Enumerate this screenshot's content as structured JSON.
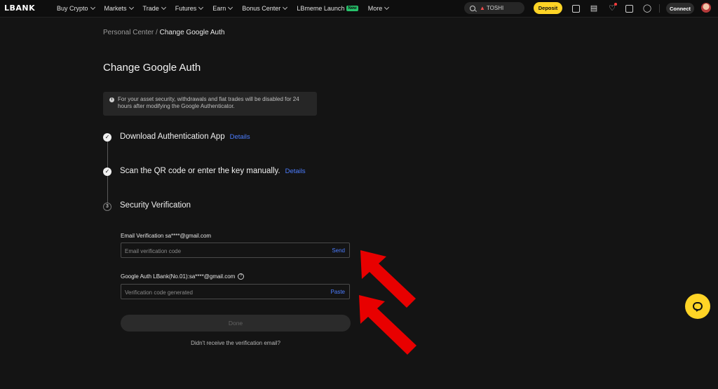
{
  "nav": {
    "logo": "LBANK",
    "items": [
      {
        "label": "Buy Crypto",
        "dropdown": true
      },
      {
        "label": "Markets",
        "dropdown": true
      },
      {
        "label": "Trade",
        "dropdown": true
      },
      {
        "label": "Futures",
        "dropdown": true
      },
      {
        "label": "Earn",
        "dropdown": true
      },
      {
        "label": "Bonus Center",
        "dropdown": true
      },
      {
        "label": "LBmeme Launch",
        "badge": "New",
        "dropdown": false
      },
      {
        "label": "More",
        "dropdown": true
      }
    ],
    "search_text": "TOSHI",
    "deposit_label": "Deposit",
    "connect_label": "Connect"
  },
  "breadcrumb": {
    "parent": "Personal Center",
    "separator": "/",
    "current": "Change Google Auth"
  },
  "page_title": "Change Google Auth",
  "notice": "For your asset security, withdrawals and fiat trades will be disabled for 24 hours after modifying the Google Authenticator.",
  "steps": [
    {
      "label": "Download Authentication App",
      "link": "Details",
      "status": "done"
    },
    {
      "label": "Scan the QR code or enter the key manually.",
      "link": "Details",
      "status": "done"
    },
    {
      "label": "Security Verification",
      "number": "3",
      "status": "current"
    }
  ],
  "form": {
    "email_label": "Email Verification sa****@gmail.com",
    "email_placeholder": "Email verification code",
    "email_action": "Send",
    "google_label": "Google Auth LBank(No.01):sa****@gmail.com",
    "google_placeholder": "Verification code generated",
    "google_action": "Paste",
    "done_label": "Done",
    "resend_text": "Didn't receive the verification email?"
  },
  "colors": {
    "accent_yellow": "#ffd426",
    "link_blue": "#4c7dff",
    "annotation_red": "#e80000"
  },
  "icons": [
    "search-icon",
    "fire-icon",
    "wallet-icon",
    "orders-icon",
    "bell-icon",
    "download-icon",
    "globe-icon",
    "info-icon",
    "check-icon",
    "question-icon",
    "chat-icon"
  ]
}
